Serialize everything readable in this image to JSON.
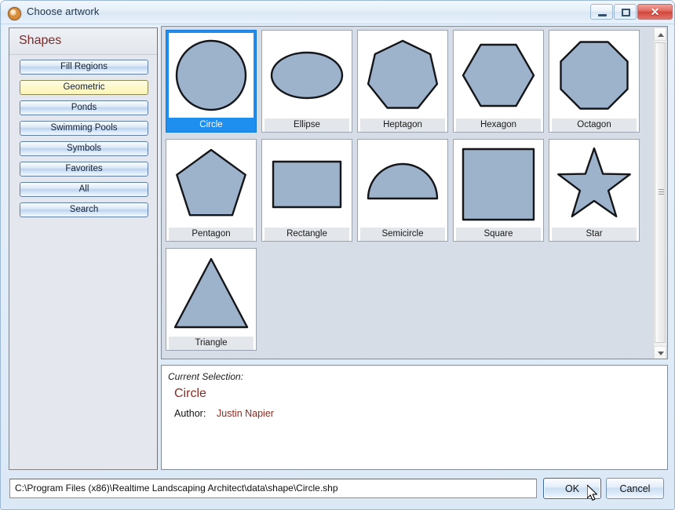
{
  "window": {
    "title": "Choose artwork",
    "icon": "artwork-palette-icon",
    "minimize_label": "",
    "maximize_label": "",
    "close_label": "✕"
  },
  "sidebar": {
    "title": "Shapes",
    "items": [
      {
        "label": "Fill Regions",
        "active": false
      },
      {
        "label": "Geometric",
        "active": true
      },
      {
        "label": "Ponds",
        "active": false
      },
      {
        "label": "Swimming Pools",
        "active": false
      },
      {
        "label": "Symbols",
        "active": false
      },
      {
        "label": "Favorites",
        "active": false
      },
      {
        "label": "All",
        "active": false
      },
      {
        "label": "Search",
        "active": false
      }
    ]
  },
  "gallery": {
    "items": [
      {
        "label": "Circle",
        "shape": "circle",
        "selected": true
      },
      {
        "label": "Ellipse",
        "shape": "ellipse",
        "selected": false
      },
      {
        "label": "Heptagon",
        "shape": "heptagon",
        "selected": false
      },
      {
        "label": "Hexagon",
        "shape": "hexagon",
        "selected": false
      },
      {
        "label": "Octagon",
        "shape": "octagon",
        "selected": false
      },
      {
        "label": "Pentagon",
        "shape": "pentagon",
        "selected": false
      },
      {
        "label": "Rectangle",
        "shape": "rectangle",
        "selected": false
      },
      {
        "label": "Semicircle",
        "shape": "semicircle",
        "selected": false
      },
      {
        "label": "Square",
        "shape": "square",
        "selected": false
      },
      {
        "label": "Star",
        "shape": "star",
        "selected": false
      },
      {
        "label": "Triangle",
        "shape": "triangle",
        "selected": false
      }
    ],
    "shape_fill": "#9db2cb",
    "shape_stroke": "#14161a",
    "selection_color": "#1e8fee",
    "scrollbar": {
      "up_arrow": "scroll-up-icon",
      "down_arrow": "scroll-down-icon"
    }
  },
  "selection_panel": {
    "caption": "Current Selection:",
    "name": "Circle",
    "author_label": "Author:",
    "author_value": "Justin Napier",
    "accent_color": "#8a2b20"
  },
  "footer": {
    "path": "C:\\Program Files (x86)\\Realtime Landscaping Architect\\data\\shape\\Circle.shp",
    "ok_label": "OK",
    "cancel_label": "Cancel"
  }
}
